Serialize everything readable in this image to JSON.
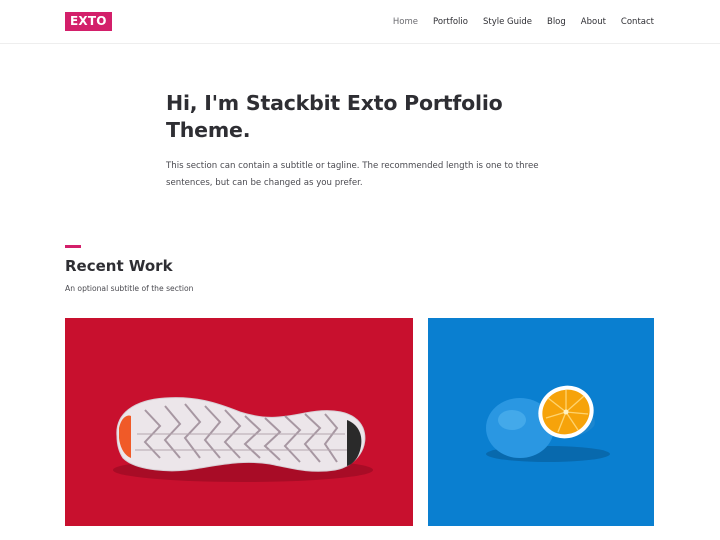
{
  "header": {
    "logo": "EXTO",
    "nav": [
      {
        "label": "Home",
        "active": true
      },
      {
        "label": "Portfolio",
        "active": false
      },
      {
        "label": "Style Guide",
        "active": false
      },
      {
        "label": "Blog",
        "active": false
      },
      {
        "label": "About",
        "active": false
      },
      {
        "label": "Contact",
        "active": false
      }
    ]
  },
  "hero": {
    "title": "Hi, I'm Stackbit Exto Portfolio Theme.",
    "subtitle": "This section can contain a subtitle or tagline. The recommended length is one to three sentences, but can be changed as you prefer."
  },
  "recent_work": {
    "title": "Recent Work",
    "subtitle": "An optional subtitle of the section",
    "items": [
      {
        "image": "sneaker-sole-on-red"
      },
      {
        "image": "blue-painted-orange-on-blue"
      }
    ]
  },
  "colors": {
    "accent": "#d31f6a",
    "card_red": "#c8102e",
    "card_blue": "#0a7fd0",
    "text": "#2e2e33"
  }
}
